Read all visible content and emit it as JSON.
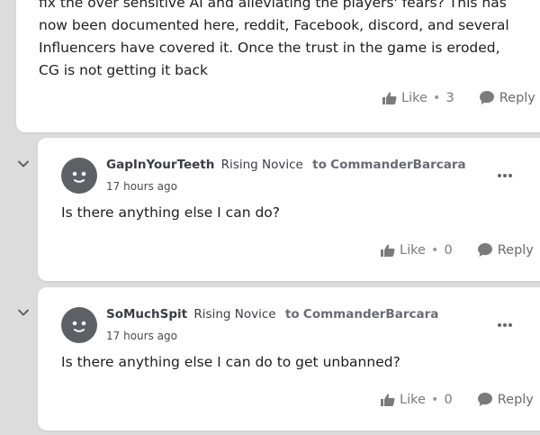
{
  "post": {
    "body": "fix the over sensitive AI and alleviating the players' fears?  This has now been documented here, reddit, Facebook, discord, and several Influencers have covered it.  Once the trust in the game is eroded, CG is not getting it back",
    "like_label": "Like",
    "like_count": "3",
    "reply_label": "Reply"
  },
  "replies": [
    {
      "author": "GapInYourTeeth",
      "rank": "Rising Novice",
      "to_label": "to",
      "target": "CommanderBarcara",
      "timestamp": "17 hours ago",
      "text": "Is there anything else I can do?",
      "like_label": "Like",
      "like_count": "0",
      "reply_label": "Reply"
    },
    {
      "author": "SoMuchSpit",
      "rank": "Rising Novice",
      "to_label": "to",
      "target": "CommanderBarcara",
      "timestamp": "17 hours ago",
      "text": "Is there anything else I can do to get unbanned?",
      "like_label": "Like",
      "like_count": "0",
      "reply_label": "Reply"
    }
  ],
  "separator": "•",
  "colors": {
    "background": "#dcdcdc",
    "card": "#ffffff",
    "avatar": "#5f6065",
    "muted_text": "#7a7a7a"
  },
  "icons": {
    "like": "thumbs-up-icon",
    "reply": "speech-bubble-icon",
    "collapse": "chevron-down-icon",
    "more": "more-options-icon",
    "avatar": "smiley-face-avatar"
  }
}
